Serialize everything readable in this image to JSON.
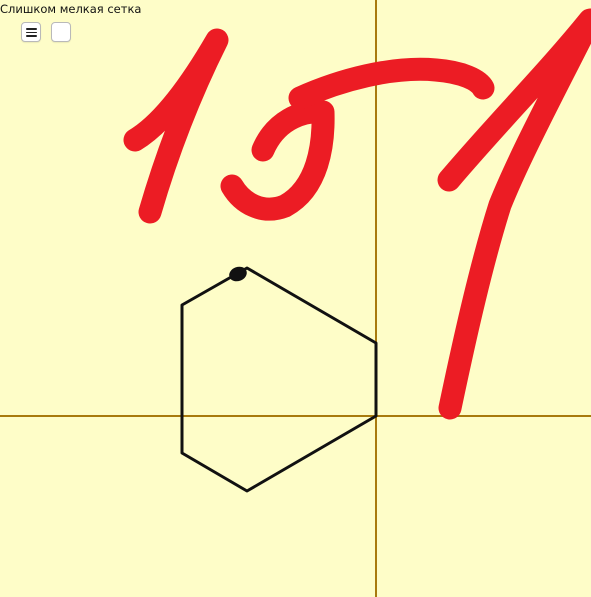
{
  "board": {
    "grid_note": "Слишком мелкая сетка",
    "background_color": "#fefdc8",
    "axis_color": "#a87a0e",
    "ink_color": "#111111",
    "marker_color": "#ec1c24"
  },
  "toolbar": {
    "menu_icon": "menu-icon",
    "blank_tool": "blank-square"
  },
  "drawing": {
    "handwritten_text": "157",
    "shape": "hexagon"
  }
}
